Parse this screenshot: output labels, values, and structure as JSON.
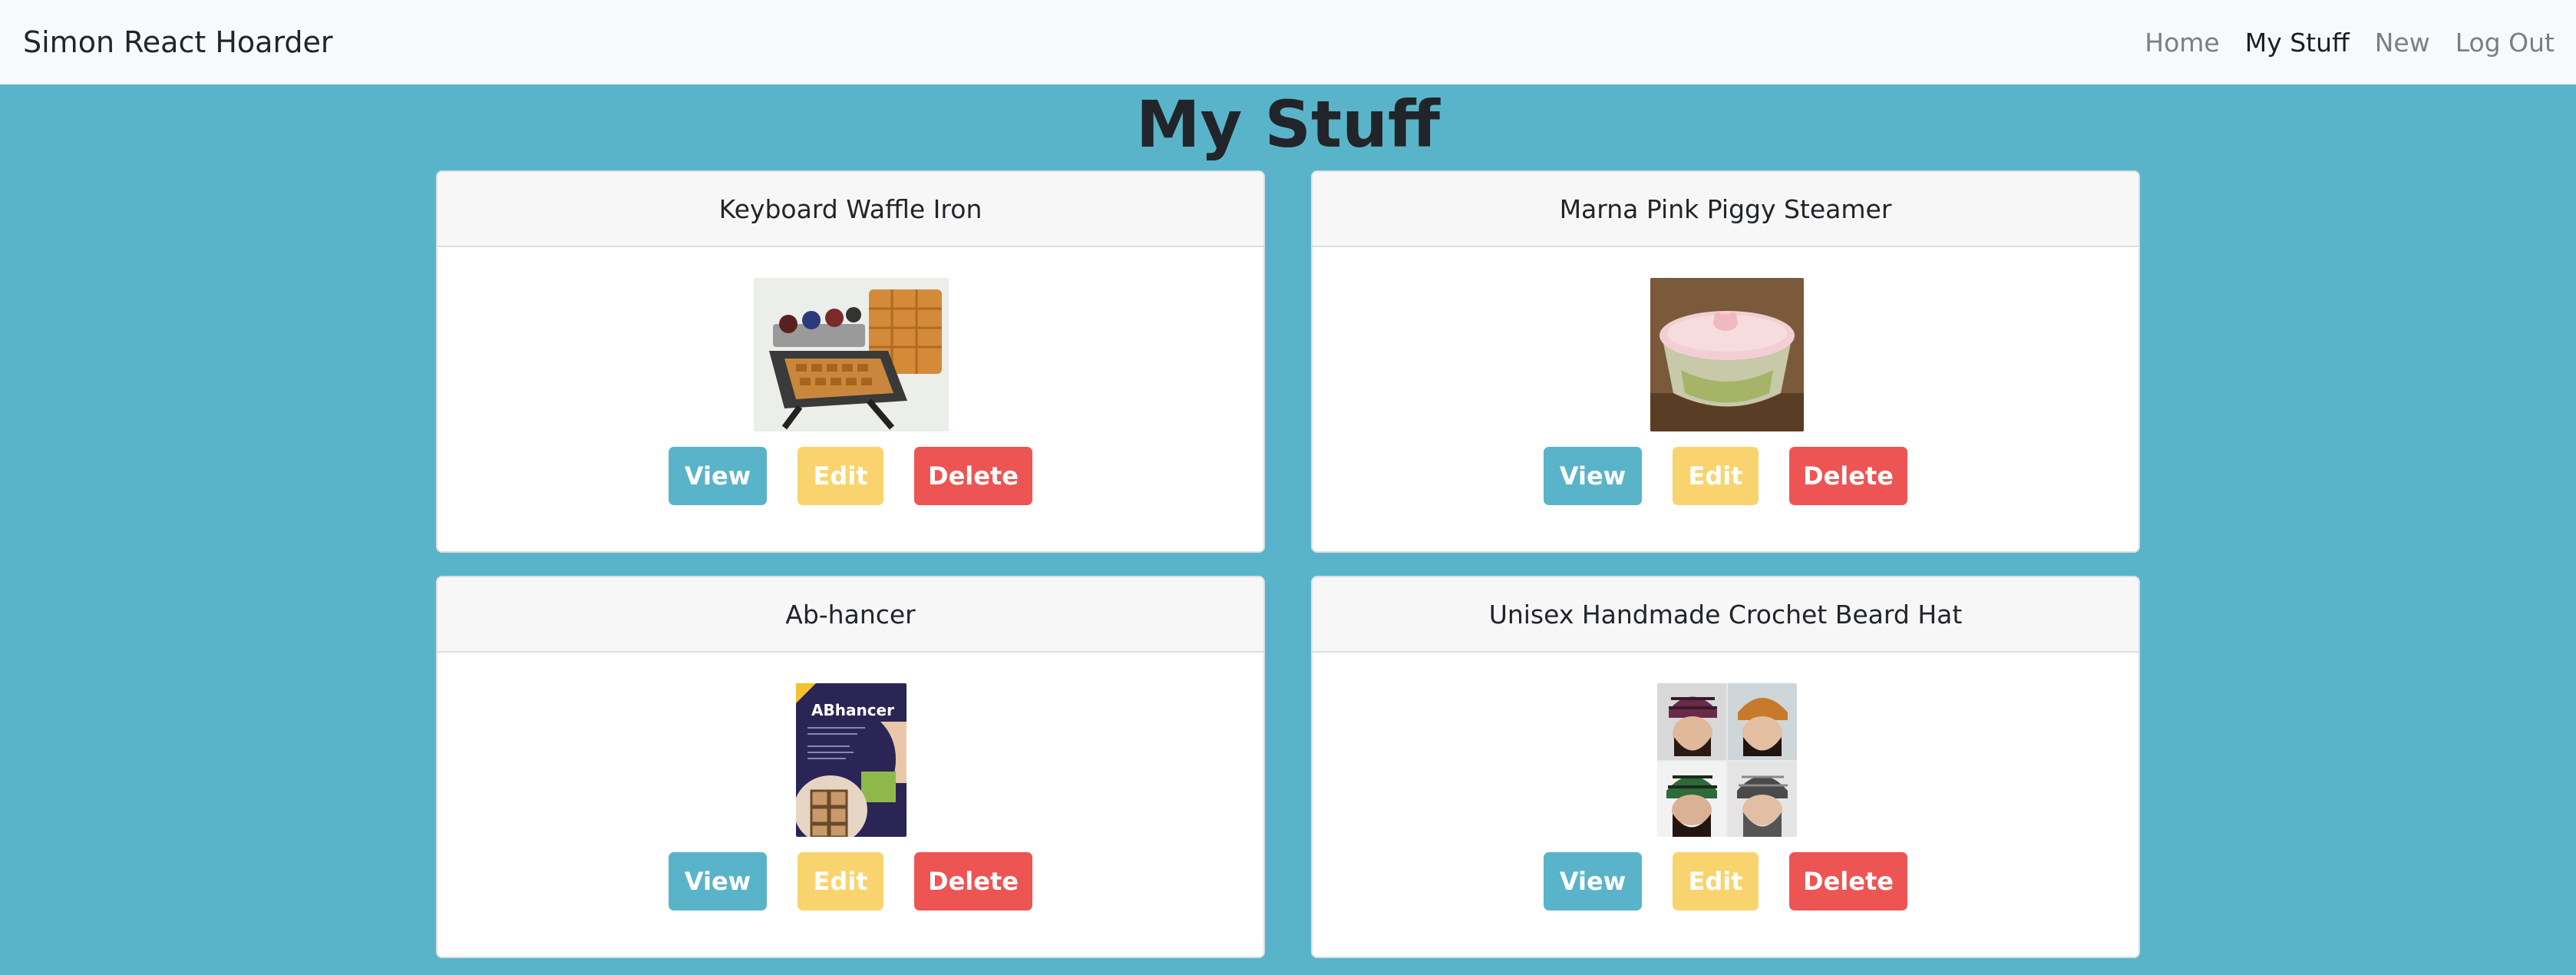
{
  "navbar": {
    "brand": "Simon React Hoarder",
    "links": [
      {
        "label": "Home",
        "active": false
      },
      {
        "label": "My Stuff",
        "active": true
      },
      {
        "label": "New",
        "active": false
      },
      {
        "label": "Log Out",
        "active": false
      }
    ]
  },
  "page": {
    "title": "My Stuff"
  },
  "items": [
    {
      "title": "Keyboard Waffle Iron",
      "image": "waffle-iron-photo"
    },
    {
      "title": "Marna Pink Piggy Steamer",
      "image": "piggy-steamer-photo"
    },
    {
      "title": "Ab-hancer",
      "image": "ab-hancer-box-photo",
      "image_text": "ABhancer"
    },
    {
      "title": "Unisex Handmade Crochet Beard Hat",
      "image": "beard-hat-collage-photo"
    }
  ],
  "buttons": {
    "view": "View",
    "edit": "Edit",
    "delete": "Delete"
  },
  "colors": {
    "background": "#5ab4c9",
    "view": "#5ab4c9",
    "edit": "#f9d46e",
    "delete": "#ec5553"
  }
}
